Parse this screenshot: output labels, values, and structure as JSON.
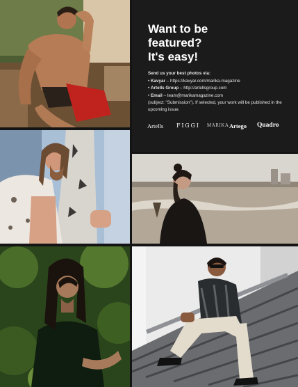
{
  "feature": {
    "headline": [
      "Want to be",
      "featured?",
      "It's easy!"
    ],
    "intro": "Send us your best photos via:",
    "channels": [
      {
        "name": "Kavyar",
        "sep": " – ",
        "detail": "https://kavyar.com/marika-magazine"
      },
      {
        "name": "Artells Group",
        "sep": " – ",
        "detail": "http://artellsgroup.com"
      },
      {
        "name": "Email",
        "sep": " – ",
        "detail": "team@marikamagazine.com"
      }
    ],
    "note": "(subject: \"Submission\"). If selected, your work will be published in the upcoming issue.",
    "logos": [
      "Artells",
      "FIGGI",
      "MARIKA",
      "Artego",
      "Quadro"
    ]
  },
  "photos": [
    {
      "id": "sunlit-portrait",
      "palette": {
        "bg": "#5a6a3a",
        "skin": "#b07a55",
        "accent": "#c0231e"
      }
    },
    {
      "id": "fur-coat-portrait",
      "palette": {
        "bg": "#9bb0c8",
        "skin": "#d8a88c",
        "accent": "#e8e6e2"
      }
    },
    {
      "id": "beach-portrait",
      "palette": {
        "bg": "#b7aea2",
        "skin": "#c49a82",
        "accent": "#1a1614"
      }
    },
    {
      "id": "greenery-portrait",
      "palette": {
        "bg": "#2c4a1c",
        "skin": "#a67a5a",
        "accent": "#0f1d10"
      }
    },
    {
      "id": "stairs-portrait",
      "palette": {
        "bg": "#e6e6e6",
        "skin": "#8a5a3f",
        "accent": "#57595c"
      }
    }
  ]
}
